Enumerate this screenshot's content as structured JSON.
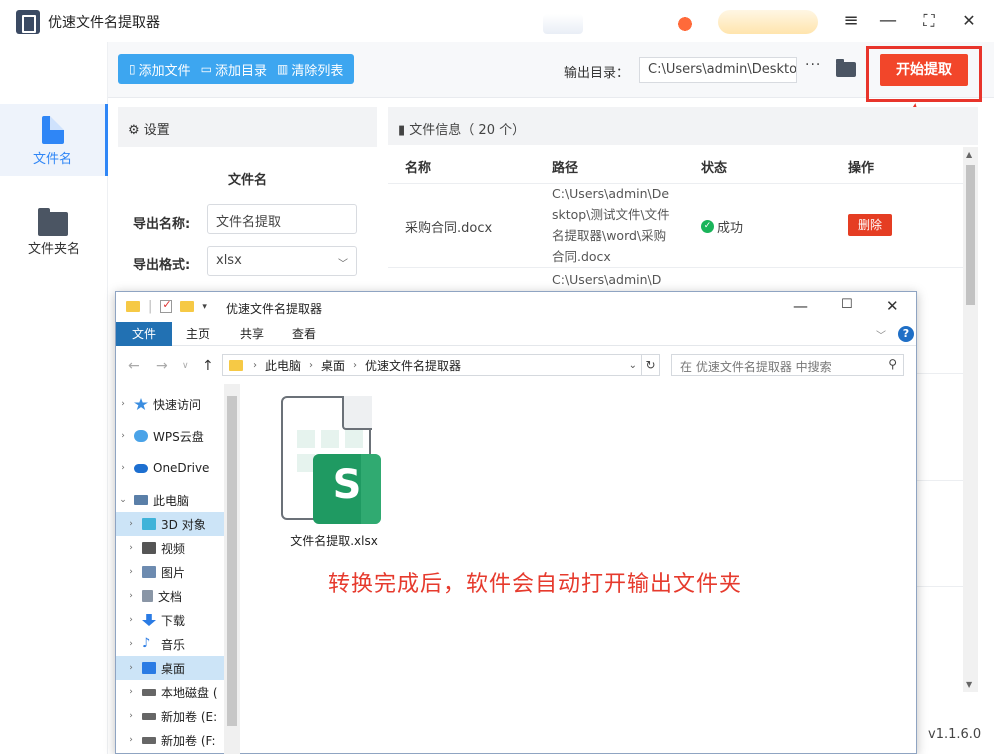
{
  "app": {
    "title": "优速文件名提取器",
    "version": "v1.1.6.0",
    "window_buttons": [
      "≡",
      "—",
      "⛶",
      "✕"
    ]
  },
  "rail": {
    "items": [
      {
        "label": "文件名",
        "active": true,
        "icon": "file-icon"
      },
      {
        "label": "文件夹名",
        "active": false,
        "icon": "folder-icon"
      }
    ]
  },
  "toolbar": {
    "add_file": "添加文件",
    "add_dir": "添加目录",
    "clear_list": "清除列表",
    "output_label": "输出目录：",
    "output_path": "C:\\Users\\admin\\Deskto",
    "more": "···",
    "start": "开始提取"
  },
  "settings": {
    "header": "设置",
    "section": "文件名",
    "export_name_label": "导出名称:",
    "export_name_value": "文件名提取",
    "export_format_label": "导出格式:",
    "export_format_value": "xlsx"
  },
  "fileinfo": {
    "header": "文件信息（ 20 个）",
    "columns": [
      "名称",
      "路径",
      "状态",
      "操作"
    ],
    "rows": [
      {
        "name": "采购合同.docx",
        "path": "C:\\Users\\admin\\Desktop\\测试文件\\文件名提取器\\word\\采购合同.docx",
        "status": "成功",
        "action": "删除"
      },
      {
        "path_partial": "C:\\Users\\admin\\D"
      }
    ]
  },
  "explorer": {
    "title": "优速文件名提取器",
    "ribbon_tabs": [
      "文件",
      "主页",
      "共享",
      "查看"
    ],
    "breadcrumb": [
      "此电脑",
      "桌面",
      "优速文件名提取器"
    ],
    "search_placeholder": "在 优速文件名提取器 中搜索",
    "nav": [
      {
        "label": "快速访问",
        "level": 0,
        "caret": "›",
        "color": "#3a8de0"
      },
      {
        "label": "WPS云盘",
        "level": 0,
        "caret": "›",
        "color": "#4aa3e8"
      },
      {
        "label": "OneDrive",
        "level": 0,
        "caret": "›",
        "color": "#1d6fd0"
      },
      {
        "label": "此电脑",
        "level": 0,
        "caret": "⌄",
        "color": "#5a7fa8"
      },
      {
        "label": "3D 对象",
        "level": 1,
        "caret": "›",
        "color": "#3fb3d9",
        "selected": true
      },
      {
        "label": "视频",
        "level": 1,
        "caret": "›",
        "color": "#555"
      },
      {
        "label": "图片",
        "level": 1,
        "caret": "›",
        "color": "#6d8bb0"
      },
      {
        "label": "文档",
        "level": 1,
        "caret": "›",
        "color": "#8a96a6"
      },
      {
        "label": "下载",
        "level": 1,
        "caret": "›",
        "color": "#2a7be4"
      },
      {
        "label": "音乐",
        "level": 1,
        "caret": "›",
        "color": "#2a7be4"
      },
      {
        "label": "桌面",
        "level": 1,
        "caret": "›",
        "color": "#2a7be4",
        "selected": true
      },
      {
        "label": "本地磁盘 (",
        "level": 1,
        "caret": "›",
        "color": "#666"
      },
      {
        "label": "新加卷 (E:",
        "level": 1,
        "caret": "›",
        "color": "#666"
      },
      {
        "label": "新加卷 (F:",
        "level": 1,
        "caret": "›",
        "color": "#666"
      }
    ],
    "file": {
      "name": "文件名提取.xlsx",
      "badge": "S"
    }
  },
  "banner": "转换完成后，软件会自动打开输出文件夹",
  "colors": {
    "accent": "#2f86f6",
    "start": "#f2462a",
    "highlight": "#e8342b",
    "success": "#1ab45a"
  }
}
